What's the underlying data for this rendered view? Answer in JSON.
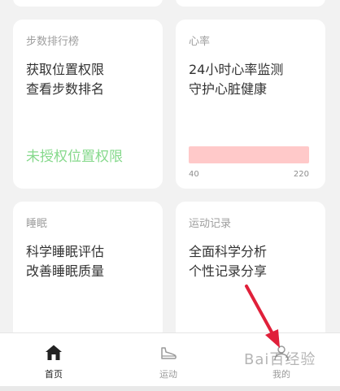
{
  "cards": {
    "steps": {
      "label": "步数排行榜",
      "line1": "获取位置权限",
      "line2": "查看步数排名",
      "status": "未授权位置权限"
    },
    "heart": {
      "label": "心率",
      "line1": "24小时心率监测",
      "line2": "守护心脏健康",
      "min": "40",
      "max": "220",
      "bar_color": "#ffc9c9"
    },
    "sleep": {
      "label": "睡眠",
      "line1": "科学睡眠评估",
      "line2": "改善睡眠质量"
    },
    "record": {
      "label": "运动记录",
      "line1": "全面科学分析",
      "line2": "个性记录分享"
    }
  },
  "nav": {
    "home": "首页",
    "sport": "运动",
    "me": "我的"
  },
  "watermark": "Bai百经验",
  "colors": {
    "accent_green": "#86d98c",
    "arrow": "#e0203a",
    "nav_active": "#222222",
    "nav_inactive": "#9a9a9a"
  }
}
